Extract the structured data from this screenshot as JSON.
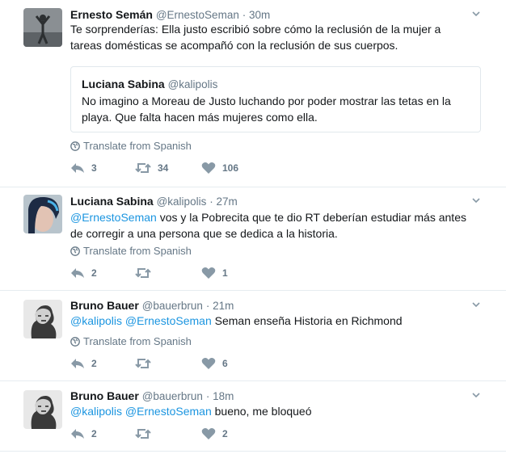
{
  "tweets": [
    {
      "name": "Ernesto Semán",
      "handle": "@ErnestoSeman",
      "time": "· 30m",
      "text": "Te sorprenderías: Ella justo escribió sobre cómo la reclusión de la mujer a tareas domésticas se acompañó con la reclusión de sus cuerpos.",
      "quote": {
        "name": "Luciana Sabina",
        "handle": "@kalipolis",
        "text": "No imagino a Moreau de Justo luchando por poder mostrar las tetas en la playa. Que falta hacen más mujeres como ella."
      },
      "translate": "Translate from Spanish",
      "reply_count": "3",
      "retweet_count": "34",
      "like_count": "106"
    },
    {
      "name": "Luciana Sabina",
      "handle": "@kalipolis",
      "time": "· 27m",
      "mention1": "@ErnestoSeman",
      "text": " vos y la Pobrecita que te dio RT deberían estudiar más antes de corregir a una persona que se dedica a la historia.",
      "translate": "Translate from Spanish",
      "reply_count": "2",
      "retweet_count": "",
      "like_count": "1"
    },
    {
      "name": "Bruno Bauer",
      "handle": "@bauerbrun",
      "time": "· 21m",
      "mention1": "@kalipolis",
      "mention2": "@ErnestoSeman",
      "text": " Seman enseña Historia en Richmond",
      "translate": "Translate from Spanish",
      "reply_count": "2",
      "retweet_count": "",
      "like_count": "6"
    },
    {
      "name": "Bruno Bauer",
      "handle": "@bauerbrun",
      "time": "· 18m",
      "mention1": "@kalipolis",
      "mention2": "@ErnestoSeman",
      "text": " bueno, me bloqueó",
      "reply_count": "2",
      "retweet_count": "",
      "like_count": "2"
    }
  ],
  "colors": {
    "link": "#1b95e0",
    "muted": "#657786",
    "border": "#e6ecf0"
  },
  "icons": [
    "reply-icon",
    "retweet-icon",
    "heart-icon",
    "globe-icon",
    "caret-down-icon"
  ]
}
